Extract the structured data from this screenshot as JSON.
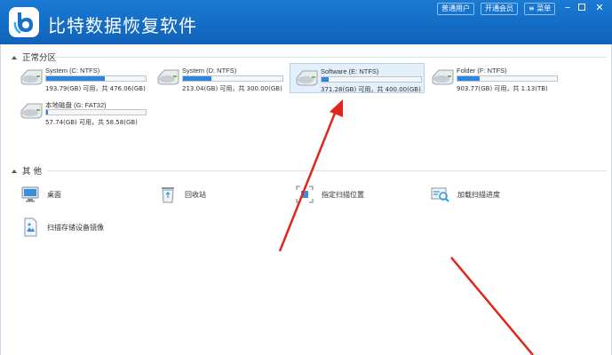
{
  "app": {
    "title": "比特数据恢复软件"
  },
  "topbar": {
    "buttons": [
      "普通用户",
      "开通会员",
      "菜单"
    ],
    "window_controls": [
      "minimize-icon",
      "maximize-icon",
      "close-icon"
    ]
  },
  "sections": {
    "partitions_title": "正常分区",
    "others_title": "其 他"
  },
  "drives": [
    {
      "name": "System (C: NTFS)",
      "size": "193.79(GB) 可用，共 476.06(GB)",
      "used_fraction": 0.59,
      "selected": false
    },
    {
      "name": "System (D: NTFS)",
      "size": "213.04(GB) 可用，共 300.00(GB)",
      "used_fraction": 0.29,
      "selected": false
    },
    {
      "name": "Software (E: NTFS)",
      "size": "371.28(GB) 可用，共 400.00(GB)",
      "used_fraction": 0.07,
      "selected": true
    },
    {
      "name": "Folder (F: NTFS)",
      "size": "903.77(GB) 可用，共 1.13(TB)",
      "used_fraction": 0.22,
      "selected": false
    },
    {
      "name": "本地磁盘 (G: FAT32)",
      "size": "57.74(GB) 可用，共 58.58(GB)",
      "used_fraction": 0.015,
      "selected": false
    }
  ],
  "tools": [
    {
      "label": "桌面",
      "icon": "desktop-icon"
    },
    {
      "label": "回收站",
      "icon": "recycle-bin-icon"
    },
    {
      "label": "指定扫描位置",
      "icon": "scan-location-icon"
    },
    {
      "label": "加载扫描进度",
      "icon": "load-progress-icon"
    },
    {
      "label": "扫描存储设备镜像",
      "icon": "disk-image-icon"
    }
  ],
  "colors": {
    "titlebar": "#1668c4",
    "bar_fill": "#2c86de",
    "arrow": "#e0251c"
  }
}
